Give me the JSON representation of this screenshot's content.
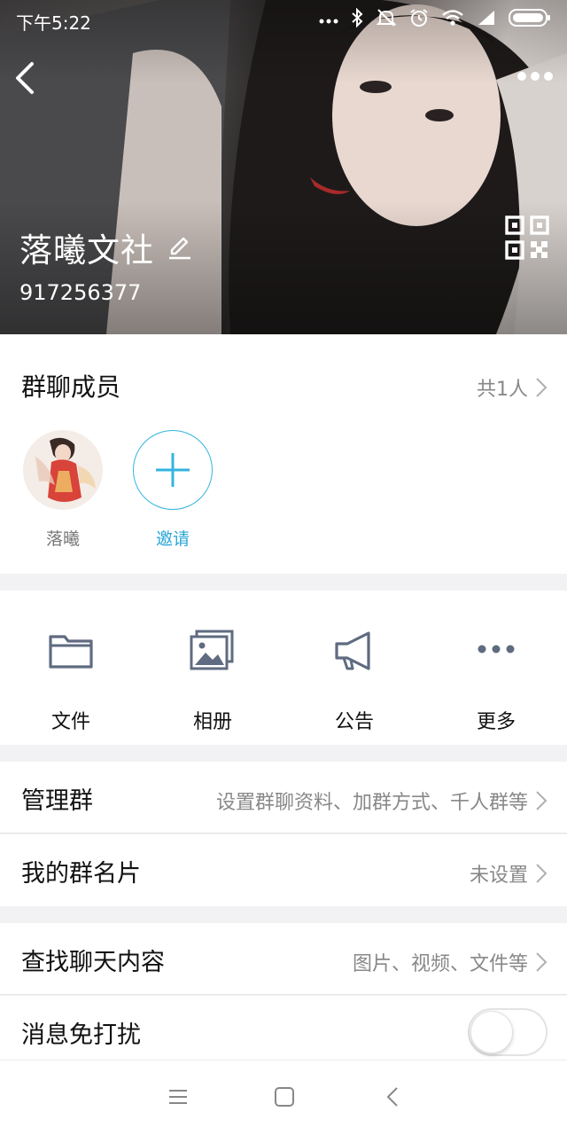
{
  "status_bar": {
    "time": "下午5:22",
    "icons": [
      "dots-icon",
      "bluetooth-icon",
      "mute-icon",
      "alarm-icon",
      "wifi-icon",
      "signal-icon",
      "battery-icon"
    ]
  },
  "group": {
    "name": "落曦文社",
    "id": "917256377"
  },
  "members": {
    "title": "群聊成员",
    "count": "共1人",
    "list": [
      {
        "name": "落曦"
      }
    ],
    "invite_label": "邀请"
  },
  "actions": [
    {
      "label": "文件",
      "icon": "folder-icon"
    },
    {
      "label": "相册",
      "icon": "album-icon"
    },
    {
      "label": "公告",
      "icon": "megaphone-icon"
    },
    {
      "label": "更多",
      "icon": "more-dots-icon"
    }
  ],
  "settings": {
    "manage": {
      "title": "管理群",
      "value": "设置群聊资料、加群方式、千人群等"
    },
    "card": {
      "title": "我的群名片",
      "value": "未设置"
    },
    "search": {
      "title": "查找聊天内容",
      "value": "图片、视频、文件等"
    },
    "mute": {
      "title": "消息免打扰",
      "enabled": false
    }
  },
  "colors": {
    "accent": "#2ba6d8",
    "icon_gray": "#5f6b80",
    "secondary_text": "#888888"
  }
}
